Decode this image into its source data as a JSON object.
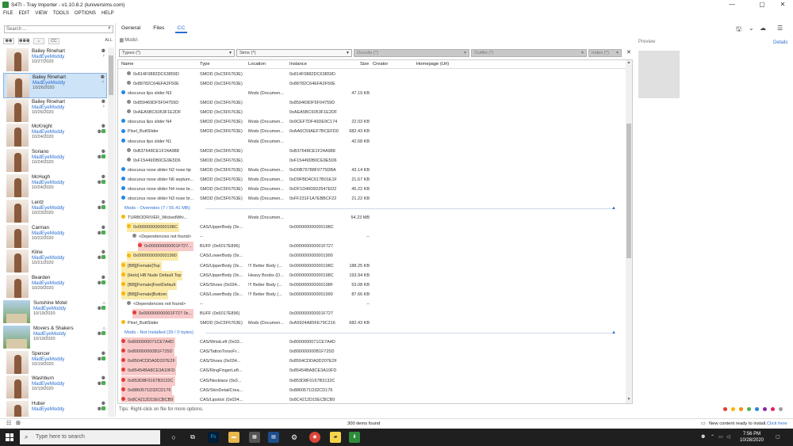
{
  "window": {
    "title": "S4TI - Tray Importer - v1.10.8.2 (luniversims.com)",
    "minimize": "—",
    "maximize": "▢",
    "close": "✕"
  },
  "menu": [
    "FILE",
    "EDIT",
    "VIEW",
    "TOOLS",
    "OPTIONS",
    "HELP"
  ],
  "sidebar": {
    "search_placeholder": "Search ...",
    "filter_all": "ALL",
    "items": [
      {
        "name": "Bailey Rinehart",
        "author": "MadEyeModdy",
        "date": "10/27/2020"
      },
      {
        "name": "Bailey Rinehart",
        "author": "MadEyeModdy",
        "date": "10/26/2020",
        "selected": true
      },
      {
        "name": "Bailey Rinehart",
        "author": "MadEyeModdy",
        "date": "10/26/2020"
      },
      {
        "name": "McKnight",
        "author": "MadEyeModdy",
        "date": "10/24/2020"
      },
      {
        "name": "Soriano",
        "author": "MadEyeModdy",
        "date": "10/24/2020"
      },
      {
        "name": "McHugh",
        "author": "MadEyeModdy",
        "date": "10/24/2020"
      },
      {
        "name": "Lentz",
        "author": "MadEyeModdy",
        "date": "10/23/2020"
      },
      {
        "name": "Carman",
        "author": "MadEyeModdy",
        "date": "10/22/2020"
      },
      {
        "name": "Kline",
        "author": "MadEyeModdy",
        "date": "10/21/2020"
      },
      {
        "name": "Bearden",
        "author": "MadEyeModdy",
        "date": "10/20/2020"
      },
      {
        "name": "Sunshine Motel",
        "author": "MadEyeModdy",
        "date": "10/19/2020",
        "lot": true
      },
      {
        "name": "Movers & Shakers",
        "author": "MadEyeModdy",
        "date": "10/19/2020",
        "lot": true
      },
      {
        "name": "Spencer",
        "author": "MadEyeModdy",
        "date": "10/19/2020"
      },
      {
        "name": "Washburn",
        "author": "MadEyeModdy",
        "date": "10/19/2020"
      },
      {
        "name": "Huber",
        "author": "MadEyeModdy",
        "date": ""
      }
    ]
  },
  "tabs": [
    {
      "label": "General",
      "active": false
    },
    {
      "label": "Files",
      "active": false
    },
    {
      "label": "CC",
      "active": true
    }
  ],
  "breadcrumb": "Mods\\",
  "filters": {
    "types": "Types (*)",
    "sims": "Sims (*)",
    "occults": "Occults (*)",
    "outfits": "Outfits (*)",
    "index": "Index (*)",
    "clear": "✕"
  },
  "columns": [
    "Name",
    "Type",
    "Location",
    "Instance",
    "Size",
    "Creator",
    "Homepage (Url)"
  ],
  "rows": [
    {
      "indent": 1,
      "dot": "#888888",
      "name": "0x814F0882DC63859D",
      "type": "SMOD (0xC5F6763E)",
      "loc": "",
      "inst": "0x814F0882DC63859D",
      "size": ""
    },
    {
      "indent": 1,
      "dot": "#888888",
      "name": "0x88782C64EFA2F50E",
      "type": "SMOD (0xC5F6763E)",
      "loc": "",
      "inst": "0x88782C64EFA2F50E",
      "size": ""
    },
    {
      "indent": 0,
      "dot": "#1e88e5",
      "name": "obscurus lips slider N3",
      "type": "",
      "loc": "Mods (Documen...",
      "inst": "",
      "size": "47.19 KB"
    },
    {
      "indent": 1,
      "dot": "#888888",
      "name": "0x859469DF5F04759D",
      "type": "SMOD (0xC5F6763E)",
      "loc": "",
      "inst": "0x859469DF5F04759D",
      "size": ""
    },
    {
      "indent": 1,
      "dot": "#888888",
      "name": "0xAEA5BC6053F1E2DF",
      "type": "SMOD (0xC5F6763E)",
      "loc": "",
      "inst": "0xAEA5BC6053F1E2DF",
      "size": ""
    },
    {
      "indent": 0,
      "dot": "#1e88e5",
      "name": "obscurus lips slider N4",
      "type": "SMOD (0xC5F6763E)",
      "loc": "Mods (Documen...",
      "inst": "0x9CEF7DF40DE9C174",
      "size": "22.03 KB"
    },
    {
      "indent": 0,
      "dot": "#1e88e5",
      "name": "Pixel_ButtSlider",
      "type": "SMOD (0xC5F6763E)",
      "loc": "Mods (Documen...",
      "inst": "0xAA6C59AEF7BCEFD0",
      "size": "682.43 KB"
    },
    {
      "indent": 0,
      "dot": "#1e88e5",
      "name": "obscurus lips slider N1",
      "type": "",
      "loc": "Mods (Documen...",
      "inst": "",
      "size": "42.68 KB"
    },
    {
      "indent": 1,
      "dot": "#888888",
      "name": "0xB37648CE1F24A988",
      "type": "SMOD (0xC5F6763E)",
      "loc": "",
      "inst": "0xB37648CE1F24A988",
      "size": ""
    },
    {
      "indent": 1,
      "dot": "#888888",
      "name": "0xF15449DB0CE9E5D6",
      "type": "SMOD (0xC5F6763E)",
      "loc": "",
      "inst": "0xF15449DB0CE9E5D6",
      "size": ""
    },
    {
      "indent": 0,
      "dot": "#1e88e5",
      "name": "obscurus nose slider N2 nose tip",
      "type": "SMOD (0xC5F6763E)",
      "loc": "Mods (Documen...",
      "inst": "0xD0B76788F9775DBA",
      "size": "43.14 KB"
    },
    {
      "indent": 0,
      "dot": "#1e88e5",
      "name": "obscurus nose slider N6 septum...",
      "type": "SMOD (0xC5F6763E)",
      "loc": "Mods (Documen...",
      "inst": "0xD9FBD4C617B01E1F",
      "size": "21.67 KB"
    },
    {
      "indent": 0,
      "dot": "#1e88e5",
      "name": "obscurus nose slider N4 nose br...",
      "type": "SMOD (0xC5F6763E)",
      "loc": "Mods (Documen...",
      "inst": "0xDF1D4606D2547ED2",
      "size": "45.22 KB"
    },
    {
      "indent": 0,
      "dot": "#1e88e5",
      "name": "obscurus nose slider N3 nose br...",
      "type": "SMOD (0xC5F6763E)",
      "loc": "Mods (Documen...",
      "inst": "0xFF231F1A7EBBCF22",
      "size": "21.22 KB"
    },
    {
      "group": true,
      "name": "Mods - Overrides  (7 / 55.41 MB)"
    },
    {
      "indent": 0,
      "dot": "#f5b800",
      "name": "TURBODRIVER_WickedWhi...",
      "type": "",
      "loc": "Mods (Documen...",
      "inst": "",
      "size": "54.23 MB"
    },
    {
      "indent": 1,
      "dot": "#f5b800",
      "pill": "y",
      "name": "0x000000000000198C",
      "type": "CAS/UpperBody (0x...",
      "loc": "",
      "inst": "0x000000000000198C",
      "size": ""
    },
    {
      "indent": 2,
      "dot": "#888888",
      "name": "<Dependencies not found>",
      "type": "--",
      "loc": "",
      "inst": "",
      "size": "--"
    },
    {
      "indent": 3,
      "dot": "#e53935",
      "pill": "r",
      "name": "0x000000000001F727...",
      "type": "BUFF (0x6017E896)",
      "loc": "",
      "inst": "0x000000000001F727",
      "size": ""
    },
    {
      "indent": 1,
      "dot": "#f5b800",
      "pill": "y",
      "name": "0x0000000000001990",
      "type": "CAS/LowerBody (0x...",
      "loc": "",
      "inst": "0x0000000000001990",
      "size": ""
    },
    {
      "indent": 0,
      "dot": "#f5b800",
      "pill": "y",
      "name": "[BB][Female]Top",
      "type": "CAS/UpperBody (0x...",
      "loc": "!!! Better Body (...",
      "inst": "0x000000000000198C",
      "size": "188.25 KB"
    },
    {
      "indent": 0,
      "dot": "#f5b800",
      "pill": "y",
      "name": "[Helo] HB Nude Default Top",
      "type": "CAS/UpperBody (0x...",
      "loc": "Heavy Boobs (D...",
      "inst": "0x000000000000198C",
      "size": "193.94 KB"
    },
    {
      "indent": 0,
      "dot": "#f5b800",
      "pill": "y",
      "name": "[BB][Female]FeetDefault",
      "type": "CAS/Shoes (0x034...",
      "loc": "!!! Better Body (...",
      "inst": "0x000000000000198F",
      "size": "53.08 KB"
    },
    {
      "indent": 0,
      "dot": "#f5b800",
      "pill": "y",
      "name": "[BB][Female]Bottom",
      "type": "CAS/LowerBody (0x...",
      "loc": "!!! Better Body (...",
      "inst": "0x0000000000001990",
      "size": "87.66 KB"
    },
    {
      "indent": 1,
      "dot": "#888888",
      "name": "<Dependencies not found>",
      "type": "--",
      "loc": "",
      "inst": "",
      "size": "--"
    },
    {
      "indent": 2,
      "dot": "#e53935",
      "pill": "r",
      "name": "0x000000000001F727 0x...",
      "type": "BUFF (0x6017E896)",
      "loc": "",
      "inst": "0x000000000001F727",
      "size": ""
    },
    {
      "indent": 0,
      "dot": "#f5b800",
      "name": "Pixel_ButtSlider",
      "type": "SMOD (0xC5F6763E)",
      "loc": "Mods (Documen...",
      "inst": "0xA5924A85FE79C216",
      "size": "682.43 KB"
    },
    {
      "group": true,
      "name": "Mods - Not Installed  (39 / 0 bytes)"
    },
    {
      "indent": 0,
      "dot": "#e53935",
      "pill": "r",
      "name": "0x8000000071CE7A4D",
      "type": "CAS/WristLeft (0x03...",
      "loc": "",
      "inst": "0x8000000071CE7A4D",
      "size": ""
    },
    {
      "indent": 0,
      "dot": "#e53935",
      "pill": "r",
      "name": "0x800000000B1F725D",
      "type": "CAS/TattooTorsoFr...",
      "loc": "",
      "inst": "0x800000000B1F725D",
      "size": ""
    },
    {
      "indent": 0,
      "dot": "#e53935",
      "pill": "r",
      "name": "0x8504CDDA0D207E2F",
      "type": "CAS/Shoes (0x034...",
      "loc": "",
      "inst": "0x8504CDDA0D207E2F",
      "size": ""
    },
    {
      "indent": 0,
      "dot": "#e53935",
      "pill": "r",
      "name": "0x85454BA8CE3A10FD",
      "type": "CAS/RingFingerLeft...",
      "loc": "",
      "inst": "0x85454BA8CE3A10FD",
      "size": ""
    },
    {
      "indent": 0,
      "dot": "#e53935",
      "pill": "r",
      "name": "0x853D8F0167B3132C",
      "type": "CAS/Necklace (0x0...",
      "loc": "",
      "inst": "0x853D8F0167B3132C",
      "size": ""
    },
    {
      "indent": 0,
      "dot": "#e53935",
      "pill": "r",
      "name": "0x8860571D32CD176",
      "type": "CAS/SkinDetailCrea...",
      "loc": "",
      "inst": "0x8860571D32CD176",
      "size": ""
    },
    {
      "indent": 0,
      "dot": "#e53935",
      "pill": "r",
      "name": "0x8C4212D15ECBCB9",
      "type": "CAS/Lipstick (0x034...",
      "loc": "",
      "inst": "0x8C4212D15ECBCB9",
      "size": ""
    }
  ],
  "preview": {
    "label": "Preview",
    "details": "Details"
  },
  "tips": "Tips:  Right-click on file for more options.",
  "status": {
    "count": "300 items found",
    "notice": "New content ready to install.",
    "notice_link": "Click here"
  },
  "colors": [
    "#e53935",
    "#f5b800",
    "#fb8c00",
    "#4caf50",
    "#1e88e5",
    "#8e24aa",
    "#e91e63",
    "#9e9e9e"
  ],
  "taskbar": {
    "search": "Type here to search",
    "time": "7:56 PM",
    "date": "10/28/2020"
  },
  "icons": [
    "search-icon",
    "windows-start-icon",
    "cortana-icon",
    "task-view-icon",
    "photoshop-icon",
    "file-explorer-icon",
    "calculator-icon",
    "settings-icon",
    "chrome-icon",
    "sticky-notes-icon",
    "tray-importer-icon"
  ]
}
